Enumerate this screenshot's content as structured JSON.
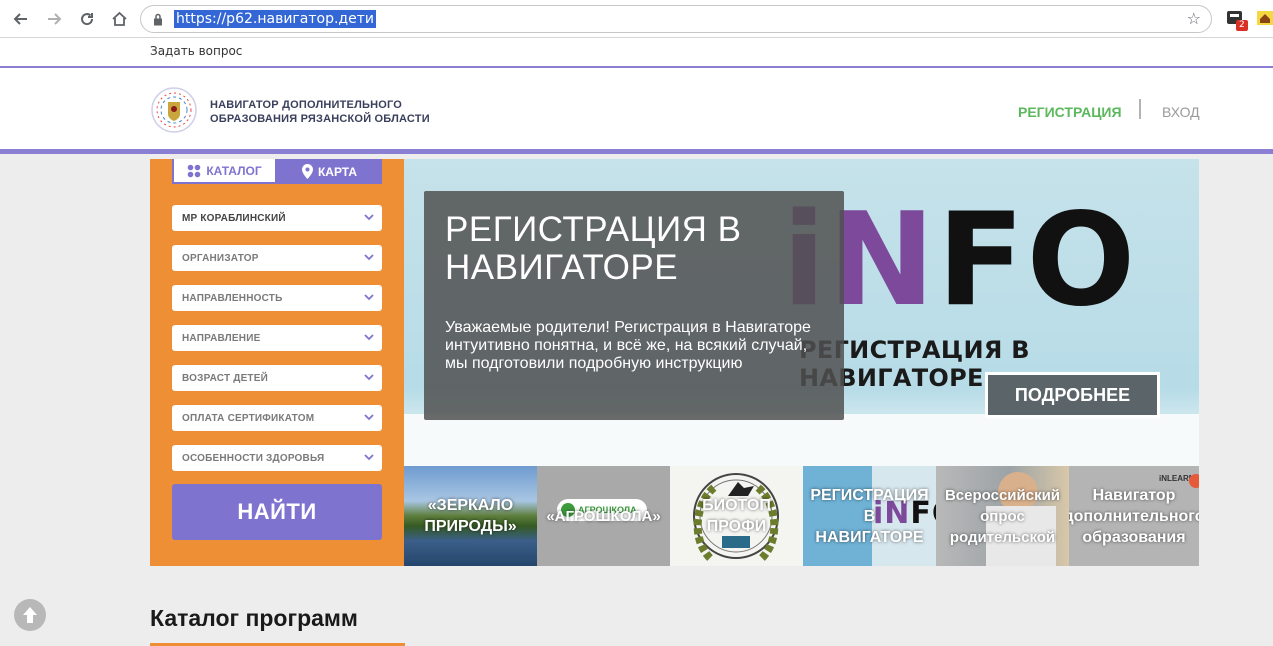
{
  "browser": {
    "url": "https://р62.навигатор.дети",
    "extension_badge": "2"
  },
  "bookmarks": {
    "item": "Задать вопрос"
  },
  "header": {
    "title_line1": "НАВИГАТОР ДОПОЛНИТЕЛЬНОГО",
    "title_line2": "ОБРАЗОВАНИЯ РЯЗАНСКОЙ ОБЛАСТИ",
    "register": "РЕГИСТРАЦИЯ",
    "login": "ВХОД"
  },
  "sidebar": {
    "tab_catalog": "КАТАЛОГ",
    "tab_map": "КАРТА",
    "filters": [
      "МР КОРАБЛИНСКИЙ",
      "ОРГАНИЗАТОР",
      "НАПРАВЛЕННОСТЬ",
      "НАПРАВЛЕНИЕ",
      "ВОЗРАСТ ДЕТЕЙ",
      "ОПЛАТА СЕРТИФИКАТОМ",
      "ОСОБЕННОСТИ ЗДОРОВЬЯ"
    ],
    "find_button": "НАЙТИ"
  },
  "banner": {
    "title": "РЕГИСТРАЦИЯ В НАВИГАТОРЕ",
    "text": "Уважаемые родители! Регистрация в Навигаторе интуитивно понятна, и всё же, на всякий случай, мы подготовили подробную инструкцию",
    "image_text_i": "i",
    "image_text_n": "N",
    "image_text_fo": "FO",
    "image_subtitle": "РЕГИСТРАЦИЯ В НАВИГАТОРЕ",
    "more_button": "ПОДРОБНЕЕ"
  },
  "thumbnails": [
    {
      "line1": "«ЗЕРКАЛО",
      "line2": "ПРИРОДЫ»",
      "line3": ""
    },
    {
      "line1": "«АГРОШКОЛА»",
      "line2": "",
      "line3": "",
      "logo_text": "АГРОШКОЛА"
    },
    {
      "line1": "БИОТОП",
      "line2": "ПРОФИ",
      "line3": ""
    },
    {
      "line1": "РЕГИСТРАЦИЯ",
      "line2": "В",
      "line3": "НАВИГАТОРЕ"
    },
    {
      "line1": "Всероссийский",
      "line2": "опрос",
      "line3": "родительской"
    },
    {
      "line1": "Навигатор",
      "line2": "дополнительного",
      "line3": "образования",
      "logo_text": "iNLEARNO"
    }
  ],
  "catalog": {
    "title": "Каталог программ"
  },
  "colors": {
    "accent_purple": "#7f73d0",
    "sidebar_orange": "#ef8f35",
    "register_green": "#5cb85c"
  }
}
